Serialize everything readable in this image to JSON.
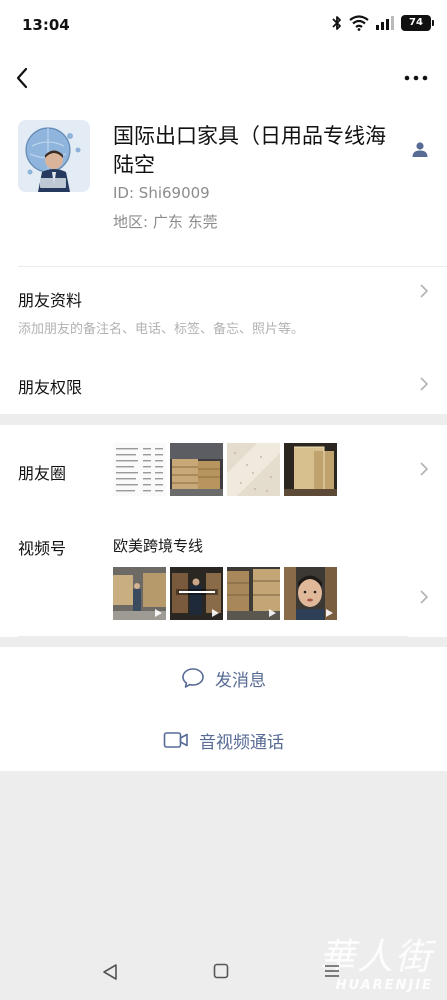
{
  "status_bar": {
    "time": "13:04",
    "battery": "74"
  },
  "profile": {
    "name": "国际出口家具（日用品专线海陆空",
    "id_text": "ID:  Shi69009",
    "region_text": "地区:  广东  东莞"
  },
  "friend_info": {
    "title": "朋友资料",
    "subtitle": "添加朋友的备注名、电话、标签、备忘、照片等。"
  },
  "friend_permissions": {
    "title": "朋友权限"
  },
  "moments": {
    "title": "朋友圈"
  },
  "channels": {
    "title": "视频号",
    "channel_name": "欧美跨境专线"
  },
  "actions": {
    "message": "发消息",
    "call": "音视频通话"
  },
  "watermark": {
    "cn": "華人街",
    "en": "HUARENJIE"
  },
  "colors": {
    "link": "#576b95",
    "background": "#ededed",
    "secondary_text": "#8c8c8c"
  }
}
